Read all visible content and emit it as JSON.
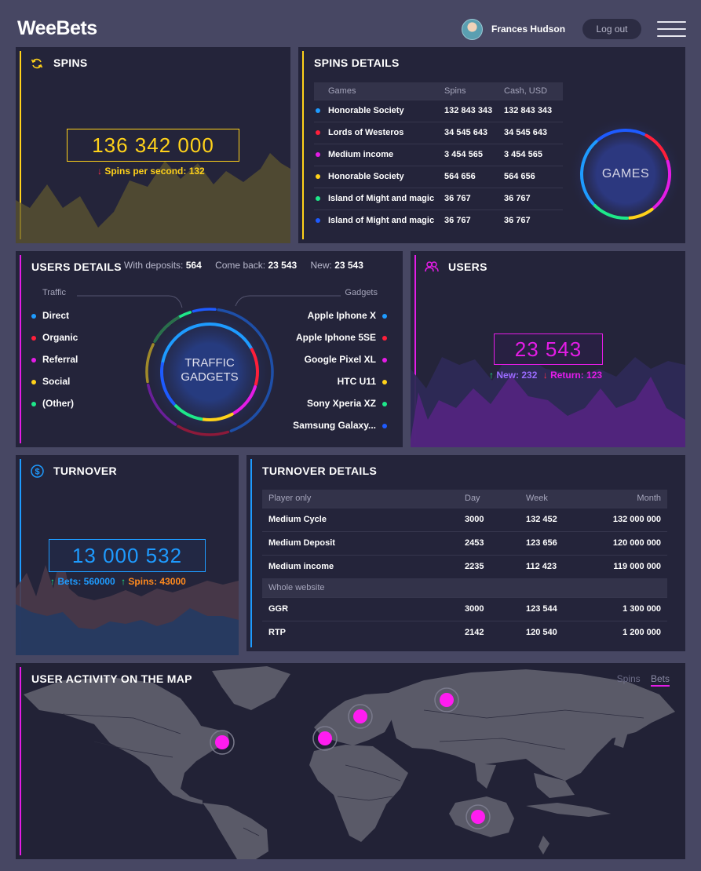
{
  "header": {
    "logo": "WeeBets",
    "user_name": "Frances Hudson",
    "logout_label": "Log out"
  },
  "spins": {
    "title": "SPINS",
    "value": "136 342 000",
    "sub_label": "Spins per second: 132",
    "color": "#ffd21a"
  },
  "spins_details": {
    "title": "SPINS DETAILS",
    "columns": [
      "Games",
      "Spins",
      "Cash, USD"
    ],
    "rows": [
      {
        "game": "Honorable Society",
        "spins": "132 843 343",
        "cash": "132 843 343",
        "color": "#1e9bff"
      },
      {
        "game": "Lords of Westeros",
        "spins": "34 545 643",
        "cash": "34 545 643",
        "color": "#ff1f3a"
      },
      {
        "game": "Medium income",
        "spins": "3 454 565",
        "cash": "3 454 565",
        "color": "#e41ce6"
      },
      {
        "game": "Honorable Society",
        "spins": "564 656",
        "cash": "564 656",
        "color": "#ffd21a"
      },
      {
        "game": "Island of Might and magic",
        "spins": "36 767",
        "cash": "36 767",
        "color": "#1ee88a"
      },
      {
        "game": "Island of Might and magic",
        "spins": "36 767",
        "cash": "36 767",
        "color": "#1e5bff"
      }
    ],
    "ring_label": "GAMES"
  },
  "users_details": {
    "title": "USERS DETAILS",
    "stats": [
      {
        "label": "With deposits:",
        "value": "564"
      },
      {
        "label": "Come back:",
        "value": "23 543"
      },
      {
        "label": "New:",
        "value": "23 543"
      }
    ],
    "traffic_heading": "Traffic",
    "gadgets_heading": "Gadgets",
    "traffic": [
      {
        "label": "Direct",
        "color": "#1e9bff"
      },
      {
        "label": "Organic",
        "color": "#ff1f3a"
      },
      {
        "label": "Referral",
        "color": "#e41ce6"
      },
      {
        "label": "Social",
        "color": "#ffd21a"
      },
      {
        "label": "(Other)",
        "color": "#1ee88a"
      }
    ],
    "gadgets": [
      {
        "label": "Apple Iphone X",
        "color": "#1e9bff"
      },
      {
        "label": "Apple Iphone 5SE",
        "color": "#ff1f3a"
      },
      {
        "label": "Google Pixel XL",
        "color": "#e41ce6"
      },
      {
        "label": "HTC U11",
        "color": "#ffd21a"
      },
      {
        "label": "Sony Xperia XZ",
        "color": "#1ee88a"
      },
      {
        "label": "Samsung Galaxy...",
        "color": "#1e5bff"
      }
    ],
    "ring_label_1": "TRAFFIC",
    "ring_label_2": "GADGETS"
  },
  "users": {
    "title": "USERS",
    "value": "23 543",
    "new_label": "New: 232",
    "return_label": "Return: 123",
    "color": "#e41ce6"
  },
  "turnover": {
    "title": "TURNOVER",
    "value": "13 000 532",
    "bets_label": "Bets: 560000",
    "spins_label": "Spins: 43000",
    "color": "#1e9bff"
  },
  "turnover_details": {
    "title": "TURNOVER DETAILS",
    "columns": [
      "Player only",
      "Day",
      "Week",
      "Month"
    ],
    "player_rows": [
      {
        "name": "Medium Cycle",
        "day": "3000",
        "week": "132 452",
        "month": "132 000 000"
      },
      {
        "name": "Medium Deposit",
        "day": "2453",
        "week": "123 656",
        "month": "120 000 000"
      },
      {
        "name": "Medium income",
        "day": "2235",
        "week": "112 423",
        "month": "119 000 000"
      }
    ],
    "section_label": "Whole website",
    "site_rows": [
      {
        "name": "GGR",
        "day": "3000",
        "week": "123 544",
        "month": "1 300 000"
      },
      {
        "name": "RTP",
        "day": "2142",
        "week": "120 540",
        "month": "1 200 000"
      }
    ]
  },
  "map": {
    "title": "USER ACTIVITY ON THE MAP",
    "tabs": [
      "Spins",
      "Bets"
    ],
    "active_tab": "Bets",
    "hotspot_color": "#ff1cf0"
  }
}
